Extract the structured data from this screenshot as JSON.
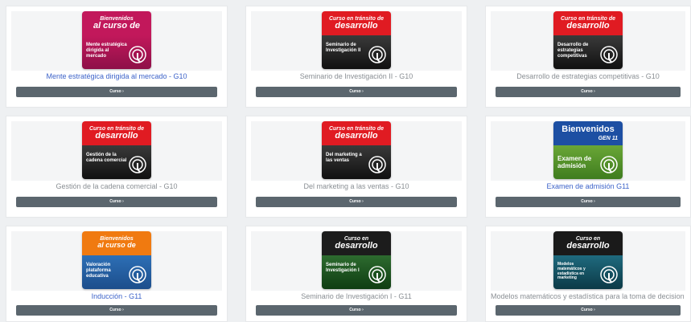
{
  "courses": [
    {
      "title": "Mente estratégica dirigida al mercado - G10",
      "thumb_top": "Bienvenidos",
      "thumb_top2": "al curso de",
      "thumb_sub": "Mente estratégica dirigida al mercado",
      "button": "Curso ›",
      "theme": "pink",
      "link": true
    },
    {
      "title": "Seminario de Investigación II - G10",
      "thumb_top": "Curso en tránsito de",
      "thumb_top2": "desarrollo",
      "thumb_sub": "Seminario de Investigación II",
      "button": "Curso ›",
      "theme": "red",
      "link": false
    },
    {
      "title": "Desarrollo de estrategias competitivas - G10",
      "thumb_top": "Curso en tránsito de",
      "thumb_top2": "desarrollo",
      "thumb_sub": "Desarrollo de estrategias competitivas",
      "button": "Curso ›",
      "theme": "red",
      "link": false
    },
    {
      "title": "Gestión de la cadena comercial - G10",
      "thumb_top": "Curso en tránsito de",
      "thumb_top2": "desarrollo",
      "thumb_sub": "Gestión de la cadena comercial",
      "button": "Curso ›",
      "theme": "red",
      "link": false
    },
    {
      "title": "Del marketing a las ventas - G10",
      "thumb_top": "Curso en tránsito de",
      "thumb_top2": "desarrollo",
      "thumb_sub": "Del marketing a las ventas",
      "button": "Curso ›",
      "theme": "red",
      "link": false
    },
    {
      "title": "Examen de admisión G11",
      "thumb_top": "Bienvenidos",
      "thumb_top2": "GEN 11",
      "thumb_sub": "Examen de admisión",
      "button": "Curso ›",
      "theme": "green",
      "link": true
    },
    {
      "title": "Inducción - G11",
      "thumb_top": "Bienvenidos",
      "thumb_top2": "al curso de",
      "thumb_sub": "Valoración plataforma educativa",
      "button": "Curso ›",
      "theme": "blue",
      "link": true
    },
    {
      "title": "Seminario de Investigación I - G11",
      "thumb_top": "Curso en",
      "thumb_top2": "desarrollo",
      "thumb_sub": "Seminario de Investigación I",
      "button": "Curso ›",
      "theme": "dark",
      "link": false
    },
    {
      "title": "Modelos matemáticos y estadística para la toma de decision",
      "thumb_top": "Curso en",
      "thumb_top2": "desarrollo",
      "thumb_sub": "Modelos matemáticos y estadística en marketing",
      "button": "Curso ›",
      "theme": "teal",
      "link": false
    }
  ]
}
